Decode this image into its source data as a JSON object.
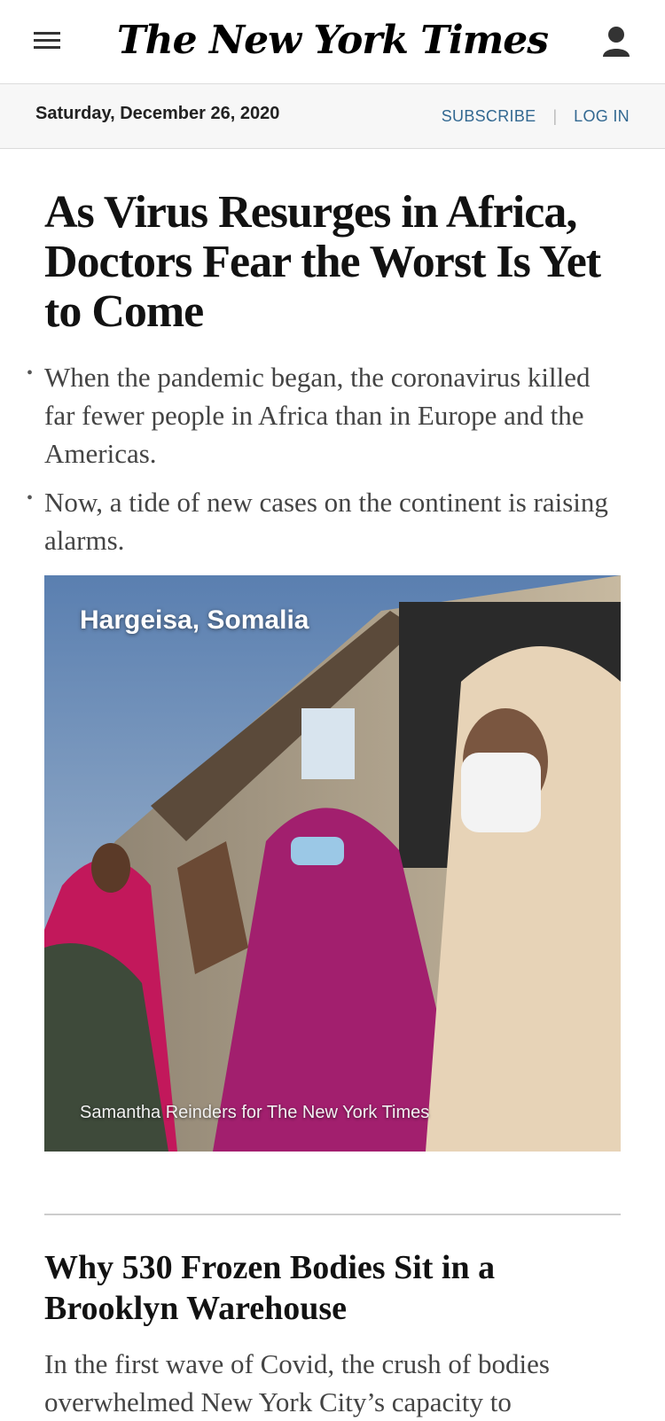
{
  "masthead": {
    "logo": "The New York Times",
    "menu_icon": "hamburger-menu-icon",
    "user_icon": "user-icon"
  },
  "datebar": {
    "date": "Saturday, December 26, 2020",
    "subscribe": "SUBSCRIBE",
    "login": "LOG IN",
    "link_color": "#326891"
  },
  "story1": {
    "headline": "As Virus Resurges in Africa, Doctors Fear the Worst Is Yet to Come",
    "bullets": [
      "When the pandemic began, the coronavirus killed far fewer people in Africa than in Europe and the Americas.",
      "Now, a tide of new cases on the continent is raising alarms."
    ],
    "photo_location": "Hargeisa, Somalia",
    "photo_credit": "Samantha Reinders for The New York Times"
  },
  "story2": {
    "headline": "Why 530 Frozen Bodies Sit in a Brooklyn Warehouse",
    "summary": "In the first wave of Covid, the crush of bodies overwhelmed New York City’s capacity to"
  }
}
